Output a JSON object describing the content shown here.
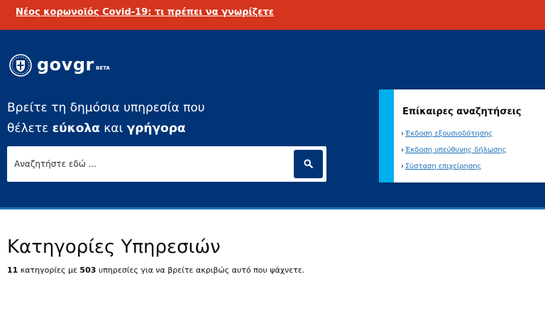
{
  "alert": {
    "link_text": "Νέος κορωνοϊός Covid-19: τι πρέπει να γνωρίζετε"
  },
  "header": {
    "logo_text": "govgr",
    "beta_label": "BETA",
    "emblem_icon": "greek-emblem-icon"
  },
  "hero": {
    "title_line1": "Βρείτε τη δημόσια υπηρεσία που",
    "title_line2_prefix": "θέλετε ",
    "title_line2_bold1": "εύκολα",
    "title_line2_middle": " και ",
    "title_line2_bold2": "γρήγορα"
  },
  "search": {
    "placeholder": "Αναζητήστε εδώ ...",
    "value": "",
    "button_icon": "search-icon"
  },
  "popular": {
    "title": "Επίκαιρες αναζητήσεις",
    "items": [
      {
        "label": "Έκδοση εξουσιοδότησης"
      },
      {
        "label": "Έκδοση υπεύθυνης δήλωσης"
      },
      {
        "label": "Σύσταση επιχείρησης"
      }
    ]
  },
  "categories": {
    "title": "Κατηγορίες Υπηρεσιών",
    "count": "11",
    "text1": " κατηγορίες με ",
    "services": "503",
    "text2": " υπηρεσίες για να βρείτε ακριβώς αυτό που ψάχνετε."
  },
  "colors": {
    "alert_bg": "#d4351c",
    "hero_bg": "#003476",
    "accent": "#00aeef",
    "link": "#1d70b8"
  }
}
